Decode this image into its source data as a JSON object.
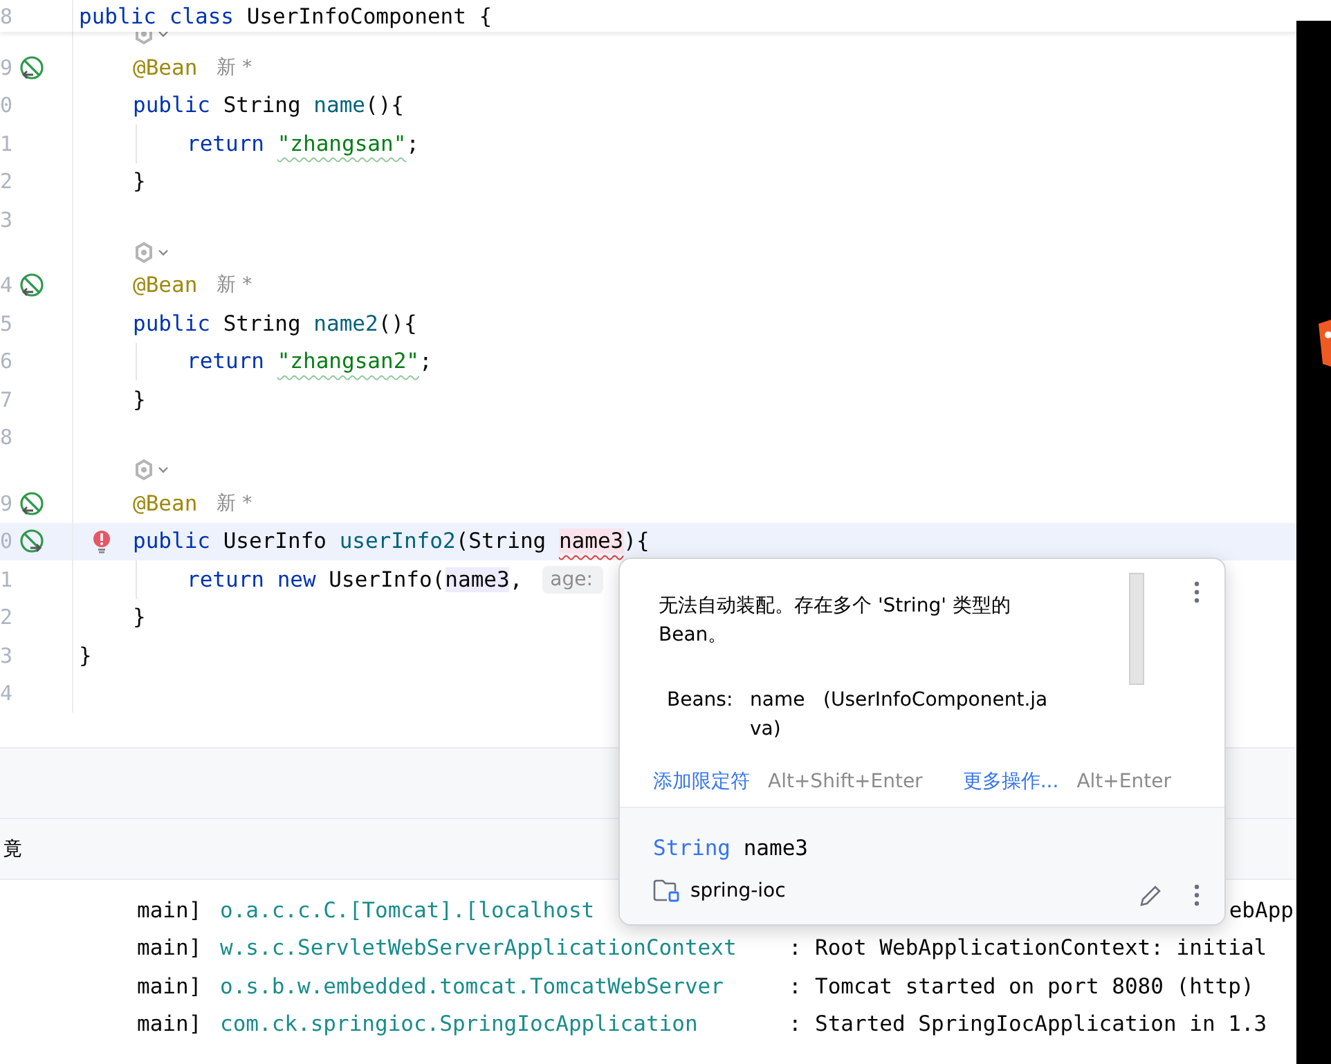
{
  "editor": {
    "lines": [
      {
        "kind": "line",
        "number": "8",
        "current": false,
        "error": false,
        "tokens": [
          {
            "kind": "keyword",
            "text": "public"
          },
          {
            "kind": "keyword",
            "text": "class",
            "gap": true
          },
          {
            "kind": "plain",
            "text": "UserInfoComponent {",
            "gap": true
          }
        ],
        "children": [
          {
            "kind": "inlay"
          },
          {
            "kind": "line",
            "number": "9",
            "marker": {
              "kind": "bean-out"
            },
            "current": false,
            "error": false,
            "tokens": [
              {
                "kind": "annotation",
                "text": "@Bean"
              },
              {
                "kind": "author",
                "text": "新 *"
              }
            ]
          },
          {
            "kind": "line",
            "number": "0",
            "current": false,
            "error": false,
            "tokens": [
              {
                "kind": "keyword",
                "text": "public"
              },
              {
                "kind": "plain",
                "text": "String",
                "gap": true
              },
              {
                "kind": "method",
                "text": "name",
                "gap": true
              },
              {
                "kind": "plain",
                "text": "(){"
              }
            ],
            "children": [
              {
                "kind": "line",
                "number": "1",
                "current": false,
                "error": false,
                "tokens": [
                  {
                    "kind": "keyword",
                    "text": "return"
                  },
                  {
                    "kind": "string",
                    "text": "\"zhangsan\"",
                    "gap": true
                  },
                  {
                    "kind": "plain",
                    "text": ";"
                  }
                ]
              }
            ]
          },
          {
            "kind": "line",
            "number": "2",
            "current": false,
            "error": false,
            "tokens": [
              {
                "kind": "plain",
                "text": "}"
              }
            ]
          },
          {
            "kind": "line",
            "number": "3",
            "current": false,
            "error": false
          },
          {
            "kind": "inlay"
          },
          {
            "kind": "line",
            "number": "4",
            "marker": {
              "kind": "bean-out"
            },
            "current": false,
            "error": false,
            "tokens": [
              {
                "kind": "annotation",
                "text": "@Bean"
              },
              {
                "kind": "author",
                "text": "新 *"
              }
            ]
          },
          {
            "kind": "line",
            "number": "5",
            "current": false,
            "error": false,
            "tokens": [
              {
                "kind": "keyword",
                "text": "public"
              },
              {
                "kind": "plain",
                "text": "String",
                "gap": true
              },
              {
                "kind": "method",
                "text": "name2",
                "gap": true
              },
              {
                "kind": "plain",
                "text": "(){"
              }
            ],
            "children": [
              {
                "kind": "line",
                "number": "6",
                "current": false,
                "error": false,
                "tokens": [
                  {
                    "kind": "keyword",
                    "text": "return"
                  },
                  {
                    "kind": "string",
                    "text": "\"zhangsan2\"",
                    "gap": true
                  },
                  {
                    "kind": "plain",
                    "text": ";"
                  }
                ]
              }
            ]
          },
          {
            "kind": "line",
            "number": "7",
            "current": false,
            "error": false,
            "tokens": [
              {
                "kind": "plain",
                "text": "}"
              }
            ]
          },
          {
            "kind": "line",
            "number": "8",
            "current": false,
            "error": false
          },
          {
            "kind": "inlay"
          },
          {
            "kind": "line",
            "number": "9",
            "marker": {
              "kind": "bean-out"
            },
            "current": false,
            "error": false,
            "tokens": [
              {
                "kind": "annotation",
                "text": "@Bean"
              },
              {
                "kind": "author",
                "text": "新 *"
              }
            ]
          },
          {
            "kind": "line",
            "number": "0",
            "marker": {
              "kind": "bean-in"
            },
            "current": true,
            "error": true,
            "tokens": [
              {
                "kind": "keyword",
                "text": "public"
              },
              {
                "kind": "plain",
                "text": "UserInfo",
                "gap": true
              },
              {
                "kind": "method",
                "text": "userInfo2",
                "gap": true
              },
              {
                "kind": "plain",
                "text": "(String"
              },
              {
                "kind": "error",
                "text": "name3",
                "gap": true
              },
              {
                "kind": "plain",
                "text": "){"
              }
            ],
            "children": [
              {
                "kind": "line",
                "number": "1",
                "current": false,
                "error": false,
                "tokens": [
                  {
                    "kind": "keyword",
                    "text": "return"
                  },
                  {
                    "kind": "keyword",
                    "text": "new",
                    "gap": true
                  },
                  {
                    "kind": "plain",
                    "text": "UserInfo(",
                    "gap": true
                  },
                  {
                    "kind": "reference",
                    "text": "name3"
                  },
                  {
                    "kind": "plain",
                    "text": ","
                  },
                  {
                    "kind": "hint",
                    "text": "age:",
                    "gap": true
                  }
                ]
              }
            ]
          },
          {
            "kind": "line",
            "number": "2",
            "current": false,
            "error": false,
            "tokens": [
              {
                "kind": "plain",
                "text": "}"
              }
            ]
          }
        ]
      },
      {
        "kind": "line",
        "number": "3",
        "current": false,
        "error": false,
        "tokens": [
          {
            "kind": "plain",
            "text": "}"
          }
        ]
      },
      {
        "kind": "line",
        "number": "4",
        "current": false,
        "error": false
      }
    ]
  },
  "bottom_panel": {
    "tab": "竟",
    "console": [
      {
        "thread": "main]",
        "logger": "o.a.c.c.C.[Tomcat].[localhost",
        "tail": "ebApp"
      },
      {
        "thread": "main]",
        "logger": "w.s.c.ServletWebServerApplicationContext",
        "separator": ":",
        "message": "Root WebApplicationContext: initial"
      },
      {
        "thread": "main]",
        "logger": "o.s.b.w.embedded.tomcat.TomcatWebServer",
        "separator": ":",
        "message": "Tomcat started on port 8080 (http)"
      },
      {
        "thread": "main]",
        "logger": "com.ck.springioc.SpringIocApplication",
        "separator": ":",
        "message": "Started SpringIocApplication in 1.3"
      }
    ]
  },
  "popup": {
    "message": "无法自动装配。存在多个 'String' 类型的 Bean。",
    "beans_label": "Beans:",
    "beans_value": "name   (UserInfoComponent.java)",
    "actions": [
      {
        "label": "添加限定符",
        "shortcut": "Alt+Shift+Enter"
      },
      {
        "label": "更多操作...",
        "shortcut": "Alt+Enter"
      }
    ],
    "declaration": {
      "type": "String",
      "name": "name3"
    },
    "module": "spring-ioc"
  }
}
